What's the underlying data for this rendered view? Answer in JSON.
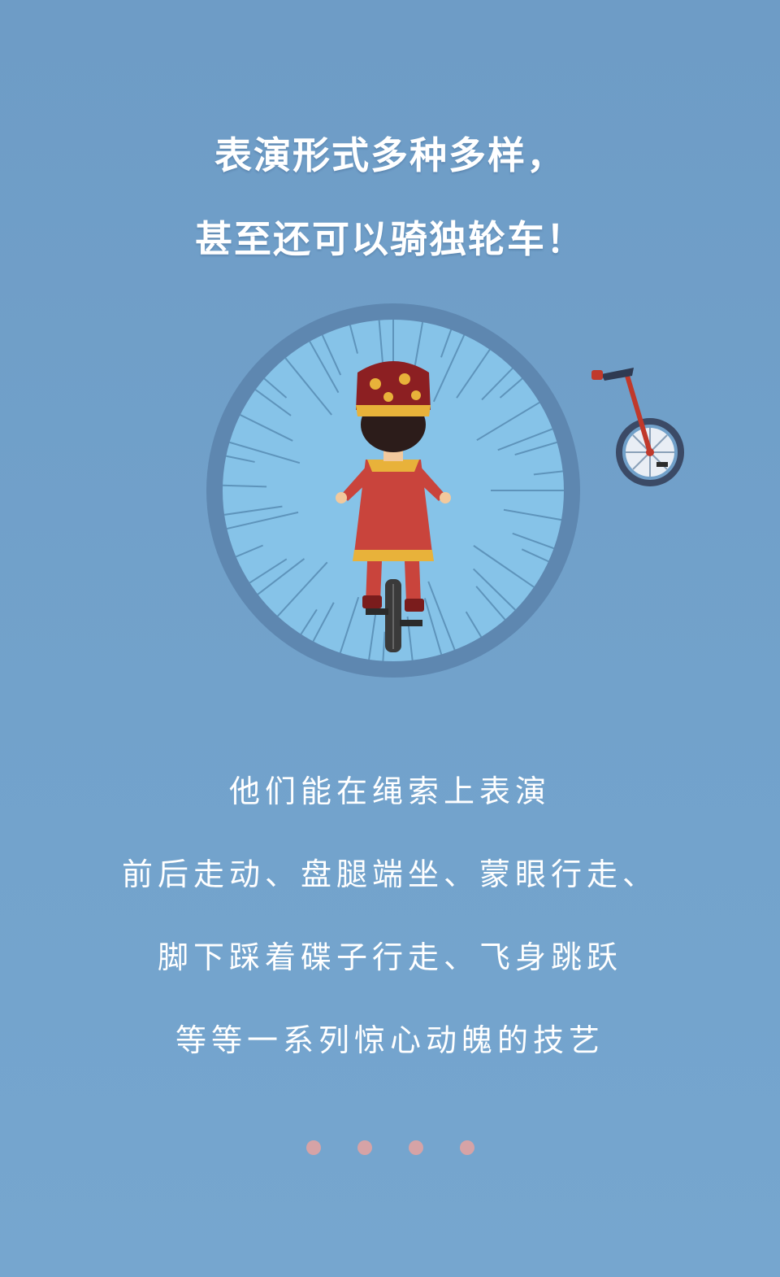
{
  "heading": {
    "line1": "表演形式多种多样，",
    "line2": "甚至还可以骑独轮车！"
  },
  "body": {
    "lines": [
      "他们能在绳索上表演",
      "前后走动、盘腿端坐、蒙眼行走、",
      "脚下踩着碟子行走、飞身跳跃",
      "等等一系列惊心动魄的技艺"
    ]
  },
  "illustration": {
    "main": "performer-on-unicycle",
    "side_icon": "unicycle-icon"
  },
  "pagination": {
    "count": 4,
    "dot_color": "#d6a3a6"
  },
  "colors": {
    "background": "#6e9cc6",
    "circle_ring": "#5e87b0",
    "circle_fill": "#86c3e8",
    "costume_red": "#c9443c",
    "gold": "#e8b23a"
  }
}
